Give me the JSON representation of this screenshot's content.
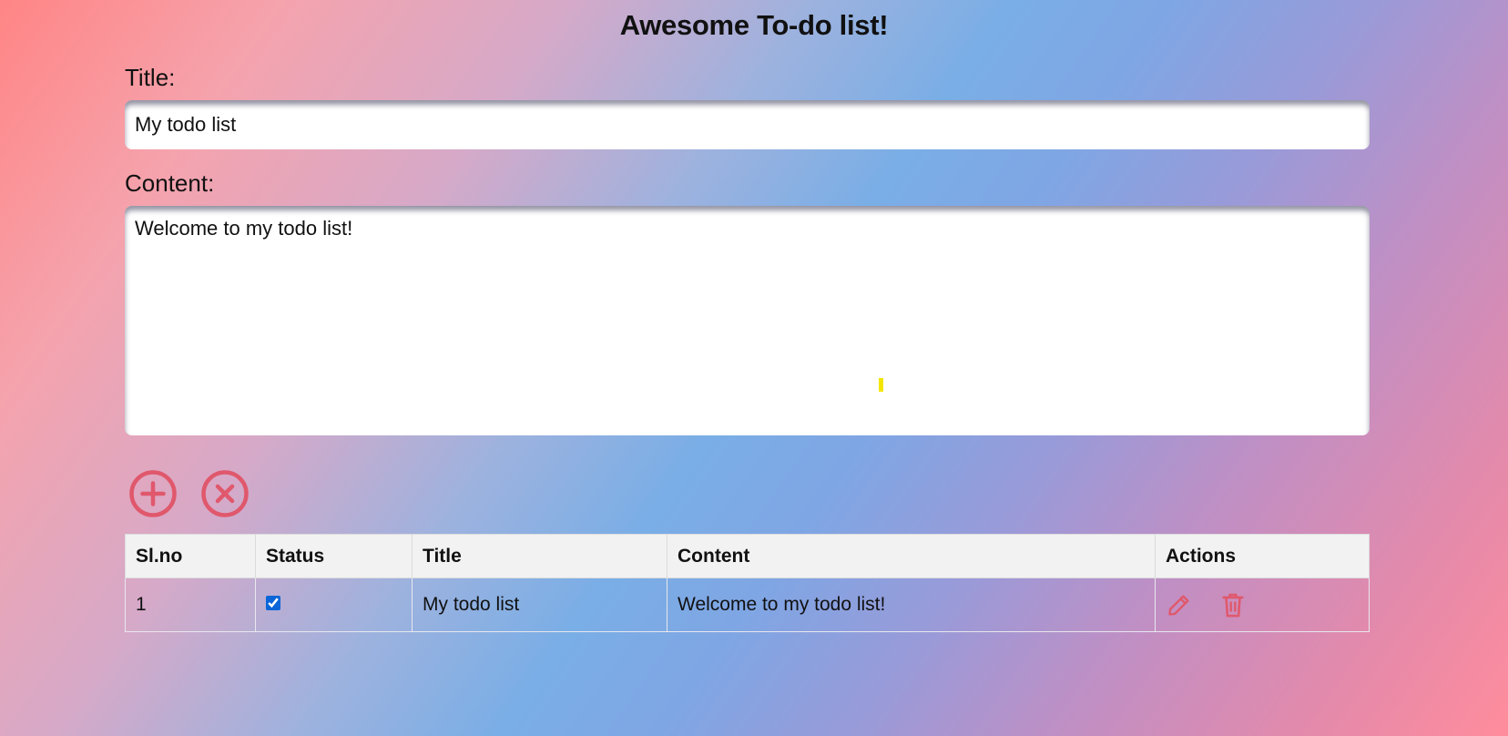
{
  "header": {
    "title": "Awesome To-do list!"
  },
  "form": {
    "title_label": "Title:",
    "title_value": "My todo list",
    "content_label": "Content:",
    "content_value": "Welcome to my todo list!"
  },
  "buttons": {
    "add_icon": "plus-circle-icon",
    "clear_icon": "x-circle-icon"
  },
  "table": {
    "headers": [
      "Sl.no",
      "Status",
      "Title",
      "Content",
      "Actions"
    ],
    "rows": [
      {
        "slno": "1",
        "status_checked": true,
        "title": "My todo list",
        "content": "Welcome to my todo list!",
        "action_icons": [
          "pencil-icon",
          "trash-icon"
        ]
      }
    ]
  },
  "colors": {
    "accent": "#e0586c",
    "header_bg": "#f2f2f2",
    "gradient": [
      "#ff8585",
      "#7aaee6",
      "#ff8c9c"
    ]
  }
}
